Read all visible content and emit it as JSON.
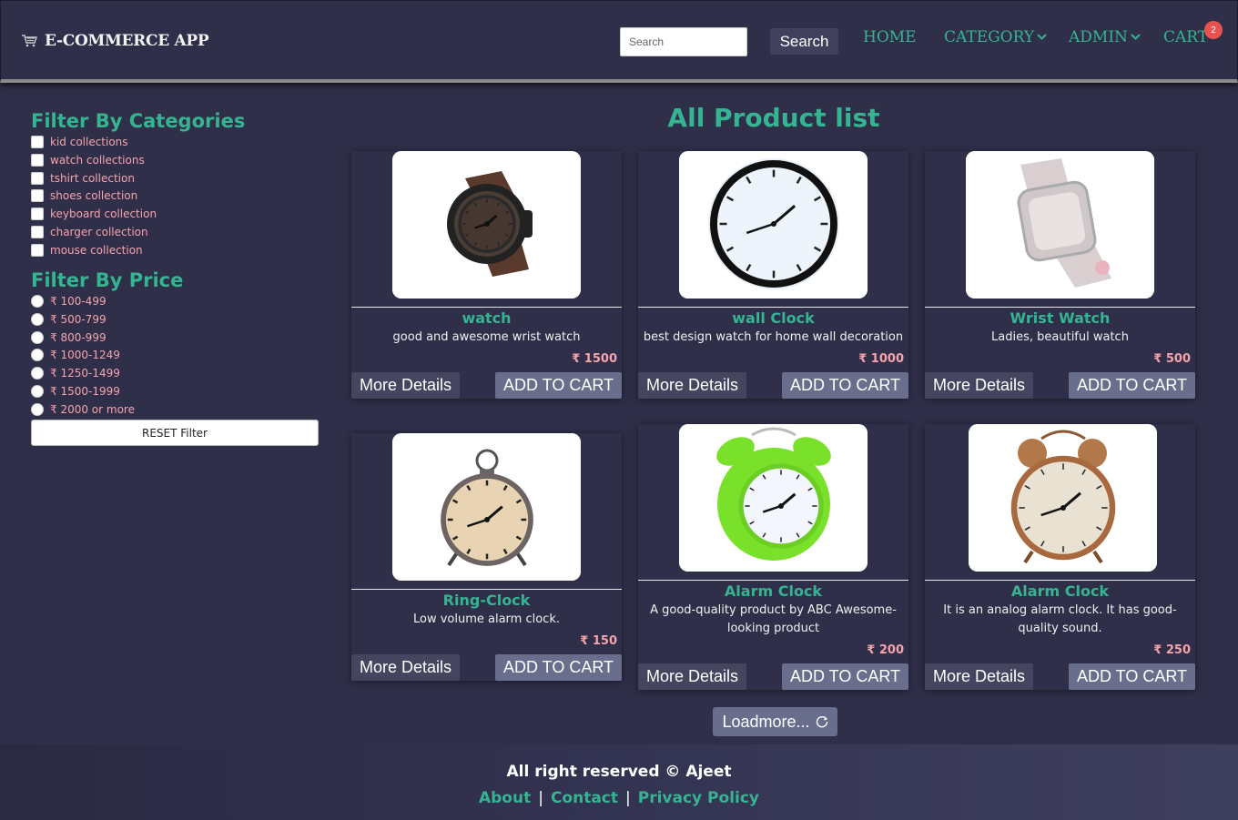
{
  "navbar": {
    "brand": "E-COMMERCE APP",
    "search_placeholder": "Search",
    "search_button": "Search",
    "links": {
      "home": "HOME",
      "category": "CATEGORY",
      "admin": "ADMIN",
      "cart": "CART"
    },
    "cart_count": "2"
  },
  "sidebar": {
    "category_heading": "Filter By Categories",
    "categories": [
      "kid collections",
      "watch collections",
      "tshirt collection",
      "shoes collection",
      "keyboard collection",
      "charger collection",
      "mouse collection"
    ],
    "price_heading": "Filter By Price",
    "prices": [
      "₹ 100-499",
      "₹ 500-799",
      "₹ 800-999",
      "₹ 1000-1249",
      "₹ 1250-1499",
      "₹ 1500-1999",
      "₹ 2000 or more"
    ],
    "reset_label": "RESET Filter"
  },
  "main": {
    "title": "All Product list",
    "more_label": "More Details",
    "add_label": "ADD TO CART",
    "loadmore_label": "Loadmore...",
    "products": [
      {
        "name": "watch",
        "desc": "good and awesome wrist watch",
        "price": "₹ 1500",
        "image": "wrist-watch-image"
      },
      {
        "name": "wall Clock",
        "desc": "best design watch for home wall decoration",
        "price": "₹ 1000",
        "image": "wall-clock-image"
      },
      {
        "name": "Wrist Watch",
        "desc": "Ladies, beautiful watch",
        "price": "₹ 500",
        "image": "diamond-watch-image"
      },
      {
        "name": "Ring-Clock",
        "desc": "Low volume alarm clock.",
        "price": "₹ 150",
        "image": "ring-clock-image"
      },
      {
        "name": "Alarm Clock",
        "desc": "A good-quality product by ABC Awesome-looking product",
        "price": "₹ 200",
        "image": "green-alarm-clock-image"
      },
      {
        "name": "Alarm Clock",
        "desc": "It is an analog alarm clock. It has good-quality sound.",
        "price": "₹ 250",
        "image": "copper-alarm-clock-image"
      }
    ]
  },
  "footer": {
    "text": "All right reserved © Ajeet",
    "links": [
      "About",
      "Contact",
      "Privacy Policy"
    ]
  },
  "colors": {
    "background": "#2f2f4a",
    "accent": "#36b491",
    "pink": "#f6a3ab",
    "badge": "#e8524e"
  }
}
